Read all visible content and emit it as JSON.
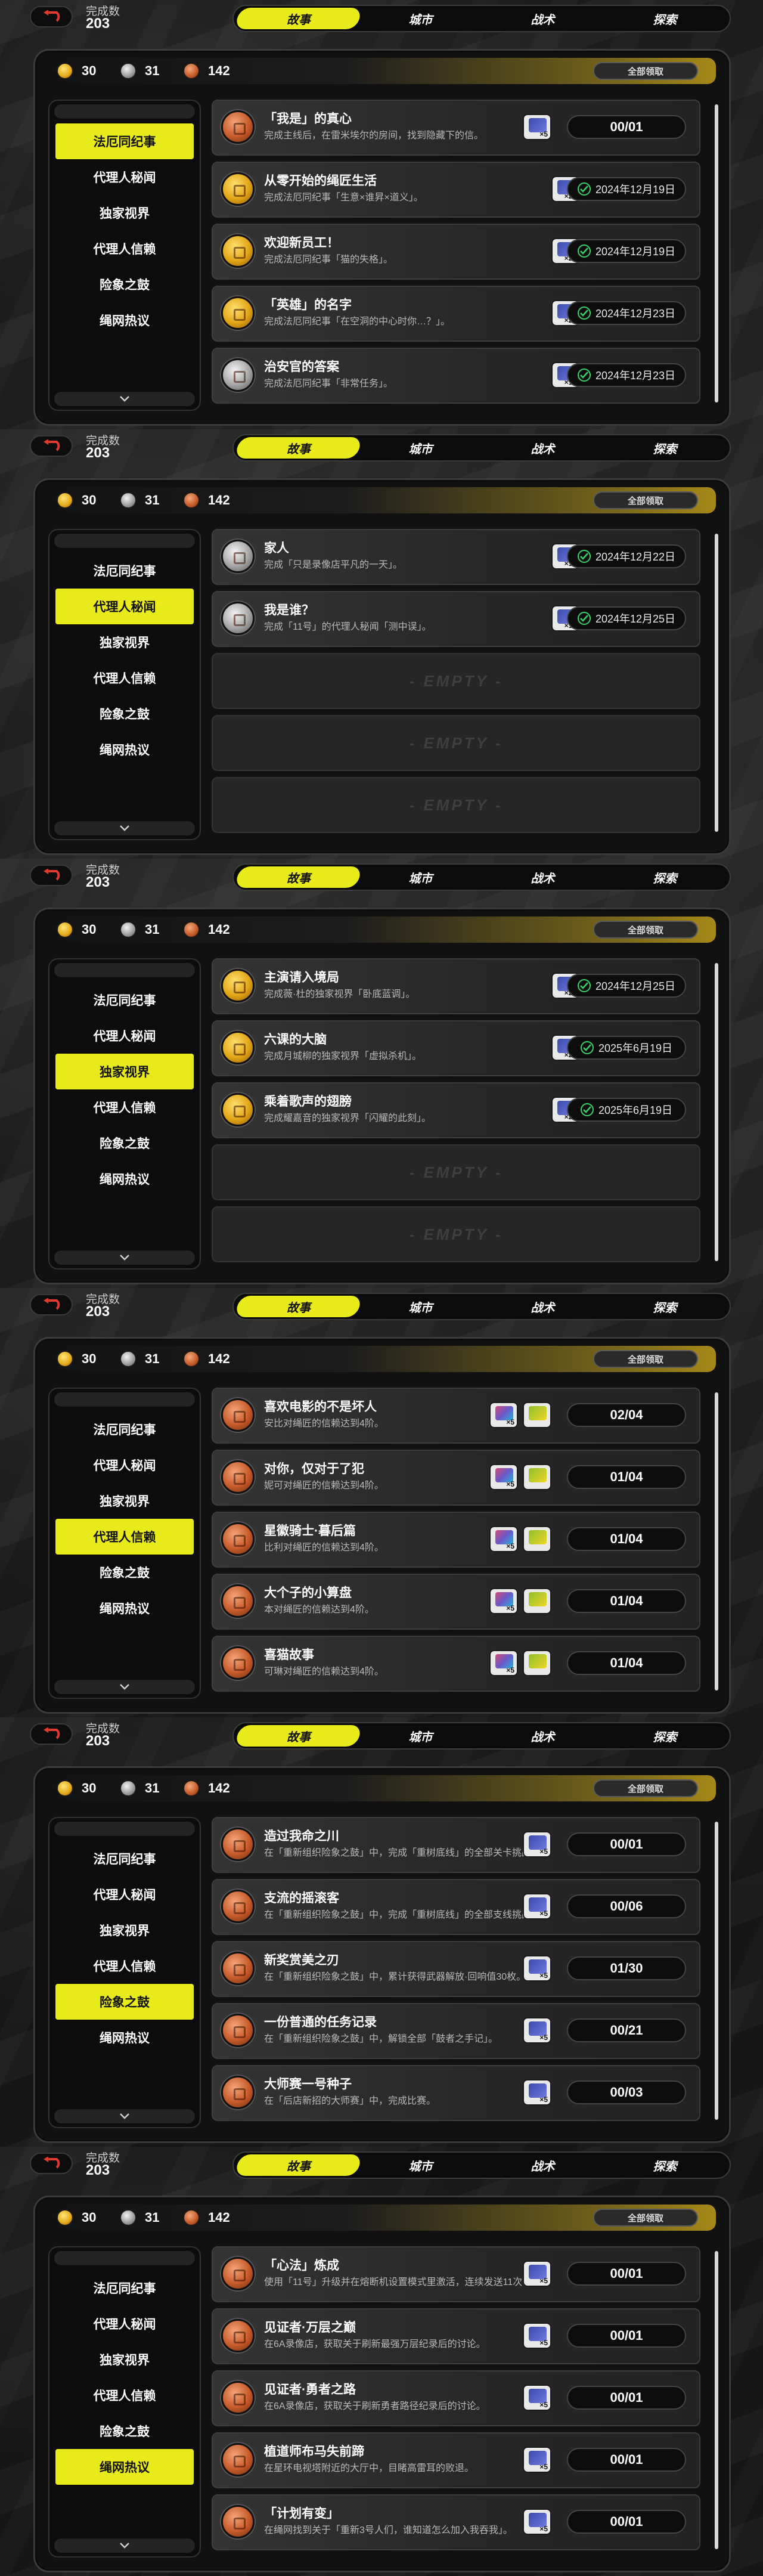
{
  "colors": {
    "accent": "#e8ea1a",
    "complete": "#39d36b",
    "bronze": "#c65a28",
    "gold": "#e2a414",
    "silver": "#a4a4a4"
  },
  "screens": [
    {
      "completion_label": "完成数",
      "completion_value": "203",
      "tabs": [
        "故事",
        "城市",
        "战术",
        "探索"
      ],
      "active_tab": 0,
      "resources": {
        "gold": "30",
        "silver": "31",
        "bronze": "142"
      },
      "claim_all": "全部领取",
      "sidebar": [
        "法厄同纪事",
        "代理人秘闻",
        "独家视界",
        "代理人信赖",
        "险象之鼓",
        "绳网热议"
      ],
      "active_side": 0,
      "rows": [
        {
          "medal": "bronze",
          "title": "「我是」的真心",
          "desc": "完成主线后，在雷米埃尔的房间，找到隐藏下的信。",
          "rewards": [
            {
              "icon": "film",
              "qty": "×5"
            }
          ],
          "status": "progress",
          "value": "00/01"
        },
        {
          "medal": "gold",
          "title": "从零开始的绳匠生活",
          "desc": "完成法厄同纪事「生意×谁昇×道义」。",
          "rewards": [
            {
              "icon": "film",
              "qty": "×20"
            }
          ],
          "status": "done",
          "value": "2024年12月19日"
        },
        {
          "medal": "gold",
          "title": "欢迎新员工！",
          "desc": "完成法厄同纪事「猫的失格」。",
          "rewards": [
            {
              "icon": "film",
              "qty": "×20"
            }
          ],
          "status": "done",
          "value": "2024年12月19日"
        },
        {
          "medal": "gold",
          "title": "「英雄」的名字",
          "desc": "完成法厄同纪事「在空洞的中心时你…？」。",
          "rewards": [
            {
              "icon": "film",
              "qty": "×20"
            }
          ],
          "status": "done",
          "value": "2024年12月23日"
        },
        {
          "medal": "silver",
          "title": "治安官的答案",
          "desc": "完成法厄同纪事「非常任务」。",
          "rewards": [
            {
              "icon": "film",
              "qty": "×10"
            }
          ],
          "status": "done",
          "value": "2024年12月23日"
        }
      ]
    },
    {
      "completion_label": "完成数",
      "completion_value": "203",
      "tabs": [
        "故事",
        "城市",
        "战术",
        "探索"
      ],
      "active_tab": 0,
      "resources": {
        "gold": "30",
        "silver": "31",
        "bronze": "142"
      },
      "claim_all": "全部领取",
      "sidebar": [
        "法厄同纪事",
        "代理人秘闻",
        "独家视界",
        "代理人信赖",
        "险象之鼓",
        "绳网热议"
      ],
      "active_side": 1,
      "rows": [
        {
          "medal": "silver",
          "title": "家人",
          "desc": "完成「只是录像店平凡的一天」。",
          "rewards": [
            {
              "icon": "film",
              "qty": "×10"
            }
          ],
          "status": "done",
          "value": "2024年12月22日"
        },
        {
          "medal": "silver",
          "title": "我是谁？",
          "desc": "完成「11号」的代理人秘闻「测中误」。",
          "rewards": [
            {
              "icon": "film",
              "qty": "×10"
            }
          ],
          "status": "done",
          "value": "2024年12月25日"
        },
        {
          "empty": "- EMPTY -"
        },
        {
          "empty": "- EMPTY -"
        },
        {
          "empty": "- EMPTY -"
        }
      ]
    },
    {
      "completion_label": "完成数",
      "completion_value": "203",
      "tabs": [
        "故事",
        "城市",
        "战术",
        "探索"
      ],
      "active_tab": 0,
      "resources": {
        "gold": "30",
        "silver": "31",
        "bronze": "142"
      },
      "claim_all": "全部领取",
      "sidebar": [
        "法厄同纪事",
        "代理人秘闻",
        "独家视界",
        "代理人信赖",
        "险象之鼓",
        "绳网热议"
      ],
      "active_side": 2,
      "rows": [
        {
          "medal": "gold",
          "title": "主演请入境局",
          "desc": "完成薇·杜的独家视界「卧底蓝调」。",
          "rewards": [
            {
              "icon": "film",
              "qty": "×20"
            }
          ],
          "status": "done",
          "value": "2024年12月25日"
        },
        {
          "medal": "gold",
          "title": "六课的大脑",
          "desc": "完成月城柳的独家视界「虚拟杀机」。",
          "rewards": [
            {
              "icon": "film",
              "qty": "×20"
            }
          ],
          "status": "done",
          "value": "2025年6月19日"
        },
        {
          "medal": "gold",
          "title": "乘着歌声的翅膀",
          "desc": "完成耀嘉音的独家视界「闪耀的此刻」。",
          "rewards": [
            {
              "icon": "film",
              "qty": "×20"
            }
          ],
          "status": "done",
          "value": "2025年6月19日"
        },
        {
          "empty": "- EMPTY -"
        },
        {
          "empty": "- EMPTY -"
        }
      ]
    },
    {
      "completion_label": "完成数",
      "completion_value": "203",
      "tabs": [
        "故事",
        "城市",
        "战术",
        "探索"
      ],
      "active_tab": 0,
      "resources": {
        "gold": "30",
        "silver": "31",
        "bronze": "142"
      },
      "claim_all": "全部领取",
      "sidebar": [
        "法厄同纪事",
        "代理人秘闻",
        "独家视界",
        "代理人信赖",
        "险象之鼓",
        "绳网热议"
      ],
      "active_side": 3,
      "rows": [
        {
          "medal": "bronze",
          "title": "喜欢电影的不是坏人",
          "desc": "安比对绳匠的信赖达到4阶。",
          "rewards": [
            {
              "icon": "multi",
              "qty": "×5"
            },
            {
              "icon": "ticket",
              "qty": ""
            }
          ],
          "status": "progress",
          "value": "02/04"
        },
        {
          "medal": "bronze",
          "title": "对你，仅对于了犯",
          "desc": "妮可对绳匠的信赖达到4阶。",
          "rewards": [
            {
              "icon": "multi",
              "qty": "×5"
            },
            {
              "icon": "ticket",
              "qty": ""
            }
          ],
          "status": "progress",
          "value": "01/04"
        },
        {
          "medal": "bronze",
          "title": "星徽骑士·暮后篇",
          "desc": "比利对绳匠的信赖达到4阶。",
          "rewards": [
            {
              "icon": "multi",
              "qty": "×5"
            },
            {
              "icon": "ticket",
              "qty": ""
            }
          ],
          "status": "progress",
          "value": "01/04"
        },
        {
          "medal": "bronze",
          "title": "大个子的小算盘",
          "desc": "本对绳匠的信赖达到4阶。",
          "rewards": [
            {
              "icon": "multi",
              "qty": "×5"
            },
            {
              "icon": "ticket",
              "qty": ""
            }
          ],
          "status": "progress",
          "value": "01/04"
        },
        {
          "medal": "bronze",
          "title": "喜猫故事",
          "desc": "可琳对绳匠的信赖达到4阶。",
          "rewards": [
            {
              "icon": "multi",
              "qty": "×5"
            },
            {
              "icon": "ticket",
              "qty": ""
            }
          ],
          "status": "progress",
          "value": "01/04"
        }
      ]
    },
    {
      "completion_label": "完成数",
      "completion_value": "203",
      "tabs": [
        "故事",
        "城市",
        "战术",
        "探索"
      ],
      "active_tab": 0,
      "resources": {
        "gold": "30",
        "silver": "31",
        "bronze": "142"
      },
      "claim_all": "全部领取",
      "sidebar": [
        "法厄同纪事",
        "代理人秘闻",
        "独家视界",
        "代理人信赖",
        "险象之鼓",
        "绳网热议"
      ],
      "active_side": 4,
      "rows": [
        {
          "medal": "bronze",
          "title": "造过我命之川",
          "desc": "在「重新组织险象之鼓」中，完成「重树底线」的全部关卡挑战。",
          "rewards": [
            {
              "icon": "film",
              "qty": "×5"
            }
          ],
          "status": "progress",
          "value": "00/01"
        },
        {
          "medal": "bronze",
          "title": "支流的摇滚客",
          "desc": "在「重新组织险象之鼓」中，完成「重树底线」的全部支线挑战。",
          "rewards": [
            {
              "icon": "film",
              "qty": "×5"
            }
          ],
          "status": "progress",
          "value": "00/06"
        },
        {
          "medal": "bronze",
          "title": "新奖赏美之刃",
          "desc": "在「重新组织险象之鼓」中，累计获得武器解放·回响值30枚。",
          "rewards": [
            {
              "icon": "film",
              "qty": "×5"
            }
          ],
          "status": "progress",
          "value": "01/30"
        },
        {
          "medal": "bronze",
          "title": "一份普通的任务记录",
          "desc": "在「重新组织险象之鼓」中，解锁全部「鼓者之手记」。",
          "rewards": [
            {
              "icon": "film",
              "qty": "×5"
            }
          ],
          "status": "progress",
          "value": "00/21"
        },
        {
          "medal": "bronze",
          "title": "大师赛一号种子",
          "desc": "在「后店新招的大师赛」中，完成比赛。",
          "rewards": [
            {
              "icon": "film",
              "qty": "×5"
            }
          ],
          "status": "progress",
          "value": "00/03"
        }
      ]
    },
    {
      "completion_label": "完成数",
      "completion_value": "203",
      "tabs": [
        "故事",
        "城市",
        "战术",
        "探索"
      ],
      "active_tab": 0,
      "resources": {
        "gold": "30",
        "silver": "31",
        "bronze": "142"
      },
      "claim_all": "全部领取",
      "sidebar": [
        "法厄同纪事",
        "代理人秘闻",
        "独家视界",
        "代理人信赖",
        "险象之鼓",
        "绳网热议"
      ],
      "active_side": 5,
      "rows": [
        {
          "medal": "bronze",
          "title": "「心法」炼成",
          "desc": "使用「11号」升级并在熔断机设置模式里激活，连续发送11次以上。",
          "rewards": [
            {
              "icon": "film",
              "qty": "×5"
            }
          ],
          "status": "progress",
          "value": "00/01"
        },
        {
          "medal": "bronze",
          "title": "见证者·万层之巅",
          "desc": "在6A录像店，获取关于刷新最强万层纪录后的讨论。",
          "rewards": [
            {
              "icon": "film",
              "qty": "×5"
            }
          ],
          "status": "progress",
          "value": "00/01"
        },
        {
          "medal": "bronze",
          "title": "见证者·勇者之路",
          "desc": "在6A录像店，获取关于刷新勇者路径纪录后的讨论。",
          "rewards": [
            {
              "icon": "film",
              "qty": "×5"
            }
          ],
          "status": "progress",
          "value": "00/01"
        },
        {
          "medal": "bronze",
          "title": "植道师布马失前蹄",
          "desc": "在星环电视塔附近的大厅中，目睹高雷耳的败退。",
          "rewards": [
            {
              "icon": "film",
              "qty": "×5"
            }
          ],
          "status": "progress",
          "value": "00/01"
        },
        {
          "medal": "bronze",
          "title": "「计划有变」",
          "desc": "在绳网找到关于「重新3号人们，谁知道怎么加入我吞我」。",
          "rewards": [
            {
              "icon": "film",
              "qty": "×5"
            }
          ],
          "status": "progress",
          "value": "00/01"
        }
      ]
    }
  ]
}
